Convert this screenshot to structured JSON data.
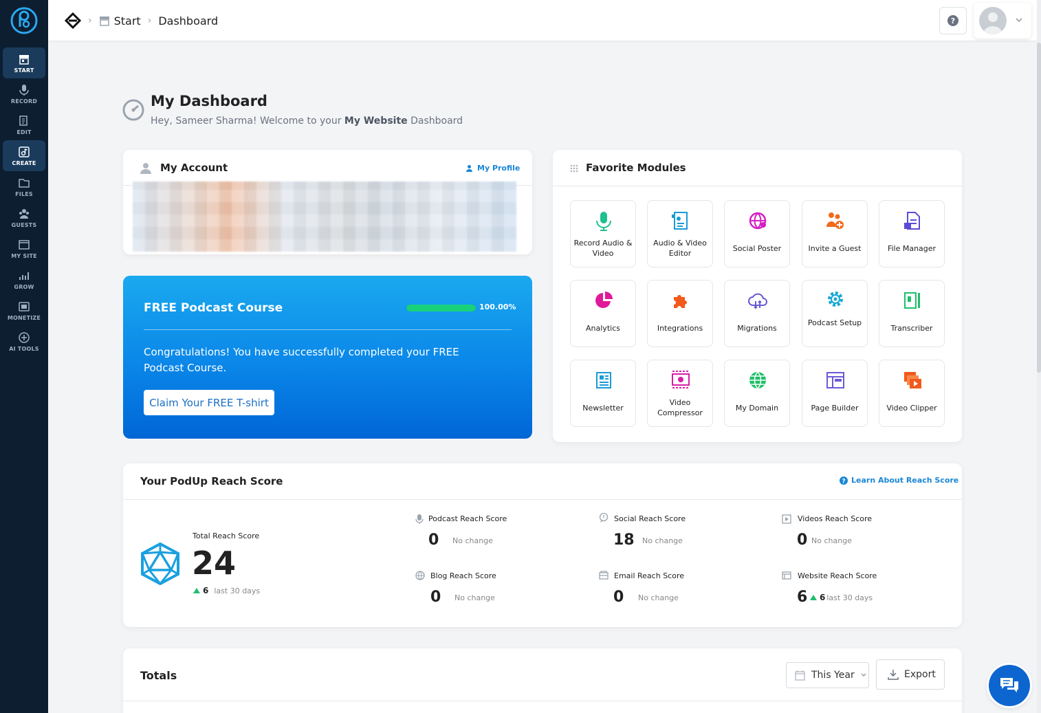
{
  "sidebar": {
    "items": [
      {
        "label": "START",
        "icon": "store-icon"
      },
      {
        "label": "RECORD",
        "icon": "mic-icon"
      },
      {
        "label": "EDIT",
        "icon": "edit-icon"
      },
      {
        "label": "CREATE",
        "icon": "create-icon"
      },
      {
        "label": "FILES",
        "icon": "files-icon"
      },
      {
        "label": "GUESTS",
        "icon": "guests-icon"
      },
      {
        "label": "MY SITE",
        "icon": "site-icon"
      },
      {
        "label": "GROW",
        "icon": "chart-icon"
      },
      {
        "label": "MONETIZE",
        "icon": "monetize-icon"
      },
      {
        "label": "AI TOOLS",
        "icon": "ai-icon"
      }
    ],
    "active": "CREATE"
  },
  "breadcrumb": {
    "start": "Start",
    "current": "Dashboard"
  },
  "page": {
    "title": "My Dashboard",
    "welcome_prefix": "Hey, Sameer Sharma! Welcome to your ",
    "welcome_site": "My Website",
    "welcome_suffix": " Dashboard"
  },
  "account": {
    "title": "My Account",
    "profile_link": "My Profile"
  },
  "course": {
    "title": "FREE Podcast Course",
    "progress_pct": "100.00%",
    "progress_value": 1.0,
    "message": "Congratulations! You have successfully completed your FREE Podcast Course.",
    "button": "Claim Your FREE T-shirt"
  },
  "favorites": {
    "title": "Favorite Modules",
    "modules": [
      {
        "label": "Record Audio & Video",
        "icon": "mic-icon",
        "color": "#1fbf8f"
      },
      {
        "label": "Audio & Video Editor",
        "icon": "editor-icon",
        "color": "#1a9ad6"
      },
      {
        "label": "Social Poster",
        "icon": "social-icon",
        "color": "#d61fc4"
      },
      {
        "label": "Invite a Guest",
        "icon": "invite-icon",
        "color": "#f26a1b"
      },
      {
        "label": "File Manager",
        "icon": "file-icon",
        "color": "#5b4bd6"
      },
      {
        "label": "Analytics",
        "icon": "pie-icon",
        "color": "#e0189a"
      },
      {
        "label": "Integrations",
        "icon": "puzzle-icon",
        "color": "#f25a1b"
      },
      {
        "label": "Migrations",
        "icon": "cloud-icon",
        "color": "#6a5ad6"
      },
      {
        "label": "Podcast Setup",
        "icon": "gear-icon",
        "color": "#17a8d6"
      },
      {
        "label": "Transcriber",
        "icon": "transcriber-icon",
        "color": "#1fbf6a"
      },
      {
        "label": "Newsletter",
        "icon": "newsletter-icon",
        "color": "#1a9ad6"
      },
      {
        "label": "Video Compressor",
        "icon": "compress-icon",
        "color": "#d61fa6"
      },
      {
        "label": "My Domain",
        "icon": "globe-icon",
        "color": "#1fbf6a"
      },
      {
        "label": "Page Builder",
        "icon": "page-icon",
        "color": "#6a5ad6"
      },
      {
        "label": "Video Clipper",
        "icon": "clipper-icon",
        "color": "#f25a1b"
      }
    ]
  },
  "reach": {
    "title": "Your PodUp Reach Score",
    "learn_link": "Learn About Reach Score",
    "total_label": "Total Reach Score",
    "total_value": "24",
    "total_change": "6",
    "total_period": "last 30 days",
    "items": [
      {
        "label": "Podcast Reach Score",
        "value": "0",
        "note": "No change",
        "icon": "mic-icon"
      },
      {
        "label": "Social Reach Score",
        "value": "18",
        "note": "No change",
        "icon": "chat-icon"
      },
      {
        "label": "Videos Reach Score",
        "value": "0",
        "note": "No change",
        "icon": "video-icon"
      },
      {
        "label": "Blog Reach Score",
        "value": "0",
        "note": "No change",
        "icon": "globe-icon"
      },
      {
        "label": "Email Reach Score",
        "value": "0",
        "note": "No change",
        "icon": "email-icon"
      },
      {
        "label": "Website Reach Score",
        "value": "6",
        "change": "6",
        "note": "last 30 days",
        "icon": "website-icon"
      }
    ]
  },
  "totals": {
    "title": "Totals",
    "period": "This Year",
    "export": "Export"
  }
}
